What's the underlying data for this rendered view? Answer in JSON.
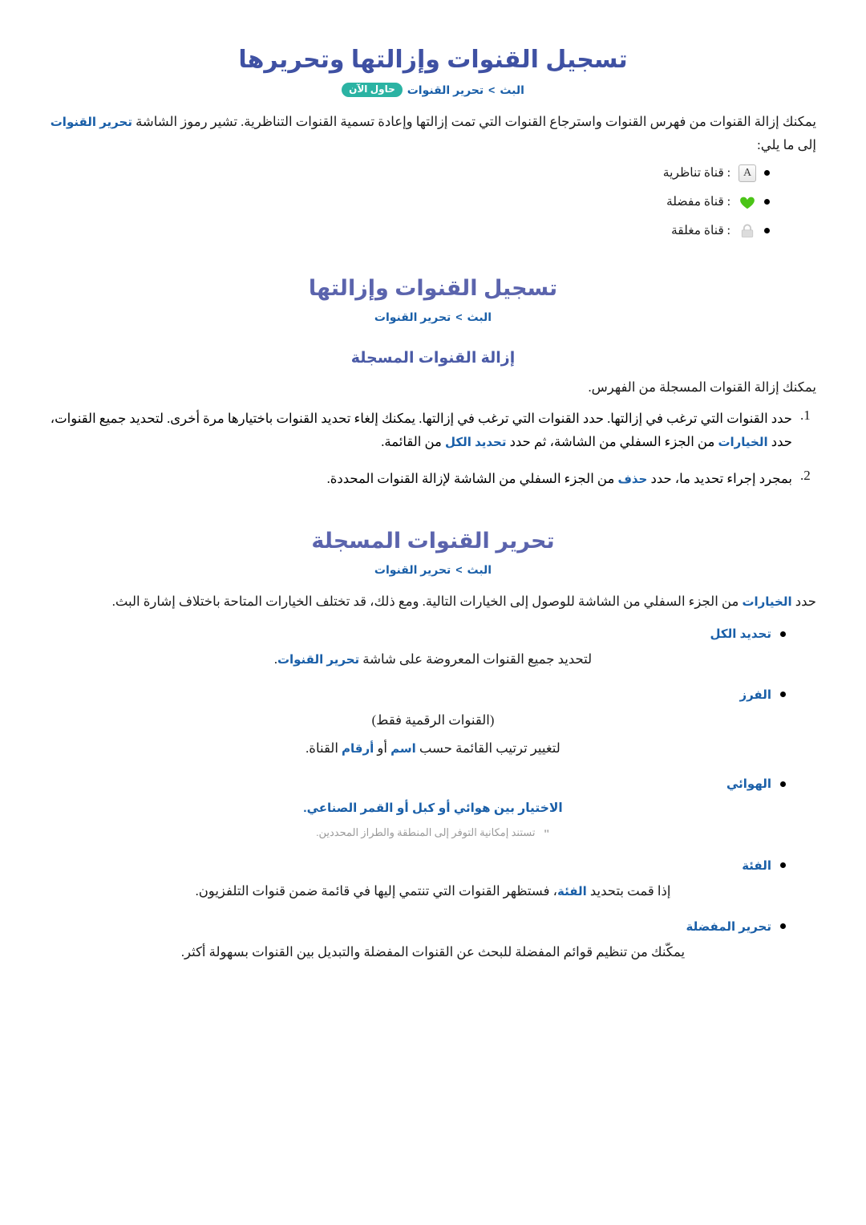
{
  "document": {
    "language": "ar",
    "colors": {
      "h1": "#3f51a3",
      "h2": "#5b64ad",
      "h3": "#4a5aa6",
      "link": "#1a5fa8",
      "badge_bg": "#2bb3a3",
      "note": "#9a9a9a",
      "body": "#1a1a1a"
    }
  },
  "section1": {
    "title": "تسجيل القنوات وإزالتها وتحريرها",
    "breadcrumb": {
      "root": "البث",
      "separator": ">",
      "leaf": "تحرير القنوات",
      "badge": "حاول الآن"
    },
    "intro_before": "يمكنك إزالة القنوات من فهرس القنوات واسترجاع القنوات التي تمت إزالتها وإعادة تسمية القنوات التناظرية. تشير رموز الشاشة",
    "intro_link": "تحرير القنوات",
    "intro_after": "إلى ما يلي:",
    "icon_items": [
      {
        "icon": "analog-channel-icon",
        "glyph": "A",
        "label": ": قناة تناظرية"
      },
      {
        "icon": "favorite-channel-icon",
        "glyph": "♥",
        "label": ": قناة مفضلة"
      },
      {
        "icon": "locked-channel-icon",
        "glyph": "🔒",
        "label": ": قناة مغلقة"
      }
    ]
  },
  "section2": {
    "title": "تسجيل القنوات وإزالتها",
    "breadcrumb": {
      "root": "البث",
      "separator": ">",
      "leaf": "تحرير القنوات"
    },
    "subsection": {
      "title": "إزالة القنوات المسجلة",
      "lead": "يمكنك إزالة القنوات المسجلة من الفهرس.",
      "steps": [
        {
          "number": "1.",
          "line1_a": "حدد القنوات التي ترغب في إزالتها. حدد القنوات التي ترغب في إزالتها. يمكنك إلغاء تحديد القنوات باختيارها مرة أخرى. لتحديد جميع القنوات، حدد",
          "line1_link": "الخيارات",
          "line1_b": "من الجزء السفلي من الشاشة، ثم",
          "line2_a": "حدد",
          "line2_link": "تحديد الكل",
          "line2_b": "من القائمة."
        },
        {
          "number": "2.",
          "line1_a": "بمجرد إجراء تحديد ما، حدد",
          "line1_link": "حذف",
          "line1_b": "من الجزء السفلي من الشاشة لإزالة القنوات المحددة."
        }
      ]
    }
  },
  "section3": {
    "title": "تحرير القنوات المسجلة",
    "breadcrumb": {
      "root": "البث",
      "separator": ">",
      "leaf": "تحرير القنوات"
    },
    "lead_a": "حدد",
    "lead_link": "الخيارات",
    "lead_b": "من الجزء السفلي من الشاشة للوصول إلى الخيارات التالية. ومع ذلك، قد تختلف الخيارات المتاحة باختلاف إشارة البث.",
    "options": [
      {
        "label": "تحديد الكل",
        "body_a": "لتحديد جميع القنوات المعروضة على شاشة",
        "body_link": "تحرير القنوات",
        "body_b": "."
      },
      {
        "label": "الفرز",
        "note_line": "(القنوات الرقمية فقط)",
        "body_a": "لتغيير ترتيب القائمة حسب",
        "body_link1": "اسم",
        "body_mid": "أو",
        "body_link2": "أرقام",
        "body_b": "القناة."
      },
      {
        "label": "الهوائي",
        "body_a": "الاختيار بين",
        "body_link1": "هوائي",
        "body_mid1": "أو",
        "body_link2": "كبل",
        "body_mid2": "أو",
        "body_link3": "القمر الصناعي",
        "body_b": ".",
        "footnote_mark": "\"",
        "footnote": "تستند إمكانية التوفر إلى المنطقة والطراز المحددين."
      },
      {
        "label": "الفئة",
        "body_a": "إذا قمت بتحديد",
        "body_link": "الفئة",
        "body_b": "، فستظهر القنوات التي تنتمي إليها في قائمة ضمن قنوات التلفزيون."
      },
      {
        "label": "تحرير المفضلة",
        "body_a": "يمكّنك من تنظيم قوائم المفضلة للبحث عن القنوات المفضلة والتبديل بين القنوات بسهولة أكثر."
      }
    ]
  }
}
